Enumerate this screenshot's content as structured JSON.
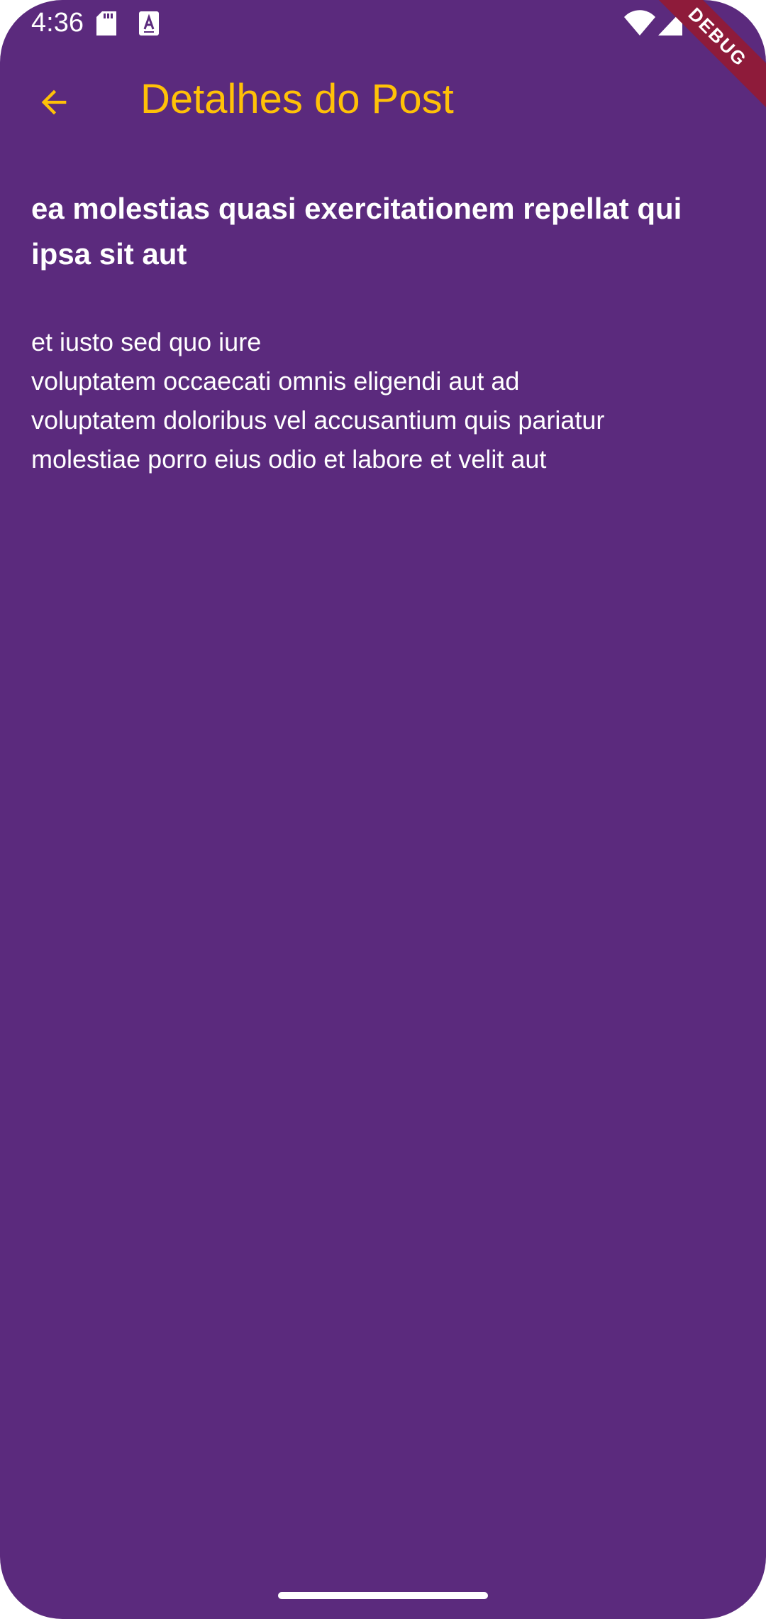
{
  "status_bar": {
    "time": "4:36",
    "icons": [
      "sd-card-icon",
      "font-a-icon",
      "wifi-icon",
      "cell-signal-icon"
    ]
  },
  "app_bar": {
    "back_icon": "arrow-back-icon",
    "title": "Detalhes do Post"
  },
  "post": {
    "title": "ea molestias quasi exercitationem repellat qui ipsa sit aut",
    "body": "et iusto sed quo iure\nvoluptatem occaecati omnis eligendi aut ad\nvoluptatem doloribus vel accusantium quis pariatur\nmolestiae porro eius odio et labore et velit aut"
  },
  "debug_banner": "DEBUG",
  "colors": {
    "background": "#5b2a7d",
    "accent": "#ffc107",
    "text": "#ffffff",
    "banner": "#8e1b3a"
  }
}
